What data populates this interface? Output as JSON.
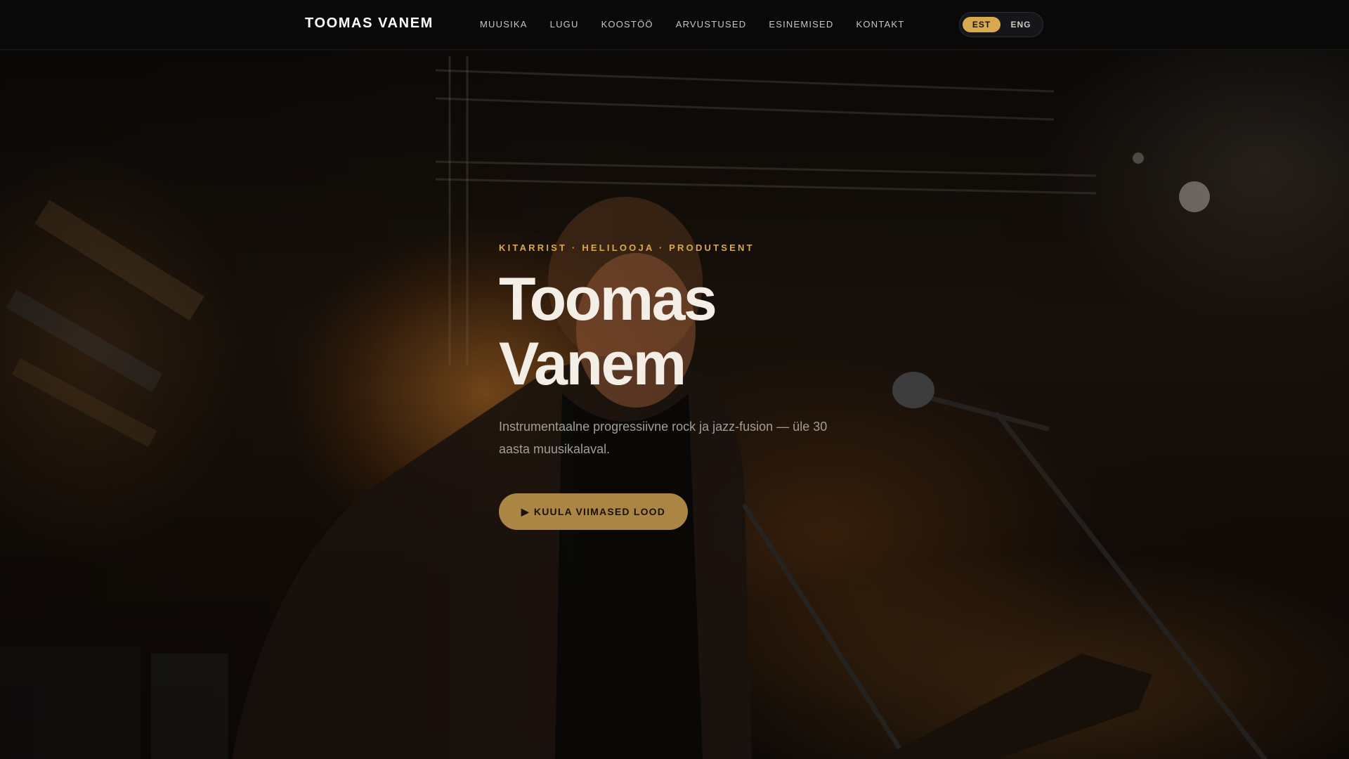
{
  "nav": {
    "brand": "TOOMAS VANEM",
    "items": [
      {
        "label": "MUUSIKA"
      },
      {
        "label": "LUGU"
      },
      {
        "label": "KOOSTÖÖ"
      },
      {
        "label": "ARVUSTUSED"
      },
      {
        "label": "ESINEMISED"
      },
      {
        "label": "KONTAKT"
      }
    ],
    "languages": {
      "active": "EST",
      "options": [
        "EST",
        "ENG"
      ]
    }
  },
  "hero": {
    "tagline": "KITARRIST · HELILOOJA · PRODUTSENT",
    "title_line1": "Toomas",
    "title_line2": "Vanem",
    "description": "Instrumentaalne progressiivne rock ja jazz-fusion — üle 30 aasta muusikalaval.",
    "cta_icon": "▶",
    "cta_label": "KUULA VIIMASED LOOD",
    "background_image": "concert-stage-photo"
  },
  "colors": {
    "accent": "#d8a94e",
    "nav_bg": "#0a0a0b",
    "text_light": "#f3eee6"
  }
}
